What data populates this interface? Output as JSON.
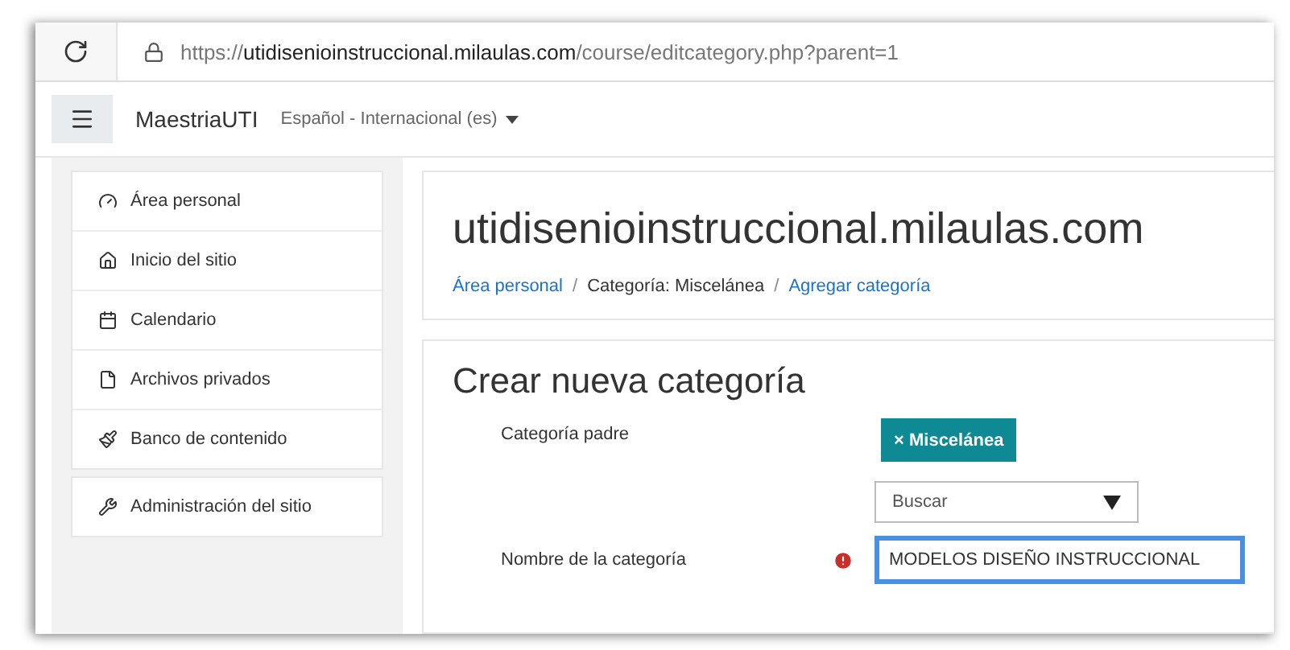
{
  "browser": {
    "url": {
      "scheme": "https://",
      "host": "utidisenioinstruccional.milaulas.com",
      "path": "/course/editcategory.php?parent=1"
    }
  },
  "navbar": {
    "brand": "MaestriaUTI",
    "language": "Español - Internacional (es)"
  },
  "sidebar": {
    "groups": [
      [
        {
          "label": "Área personal",
          "kind": "dashboard"
        },
        {
          "label": "Inicio del sitio",
          "kind": "home"
        },
        {
          "label": "Calendario",
          "kind": "calendar"
        },
        {
          "label": "Archivos privados",
          "kind": "file"
        },
        {
          "label": "Banco de contenido",
          "kind": "brush"
        }
      ],
      [
        {
          "label": "Administración del sitio",
          "kind": "wrench"
        }
      ]
    ]
  },
  "header": {
    "title": "utidisenioinstruccional.milaulas.com",
    "separator": "/",
    "breadcrumb": [
      {
        "label": "Área personal",
        "link": true
      },
      {
        "label": "Categoría: Miscelánea",
        "link": false
      },
      {
        "label": "Agregar categoría",
        "link": true
      }
    ]
  },
  "form": {
    "title": "Crear nueva categoría",
    "fields": [
      {
        "kind": "autocomplete",
        "label": "Categoría padre",
        "chip": "× Miscelánea",
        "placeholder": "Buscar",
        "required": false
      },
      {
        "kind": "text",
        "label": "Nombre de la categoría",
        "value": "MODELOS DISEÑO INSTRUCCIONAL",
        "required": true,
        "focused": true
      }
    ]
  }
}
